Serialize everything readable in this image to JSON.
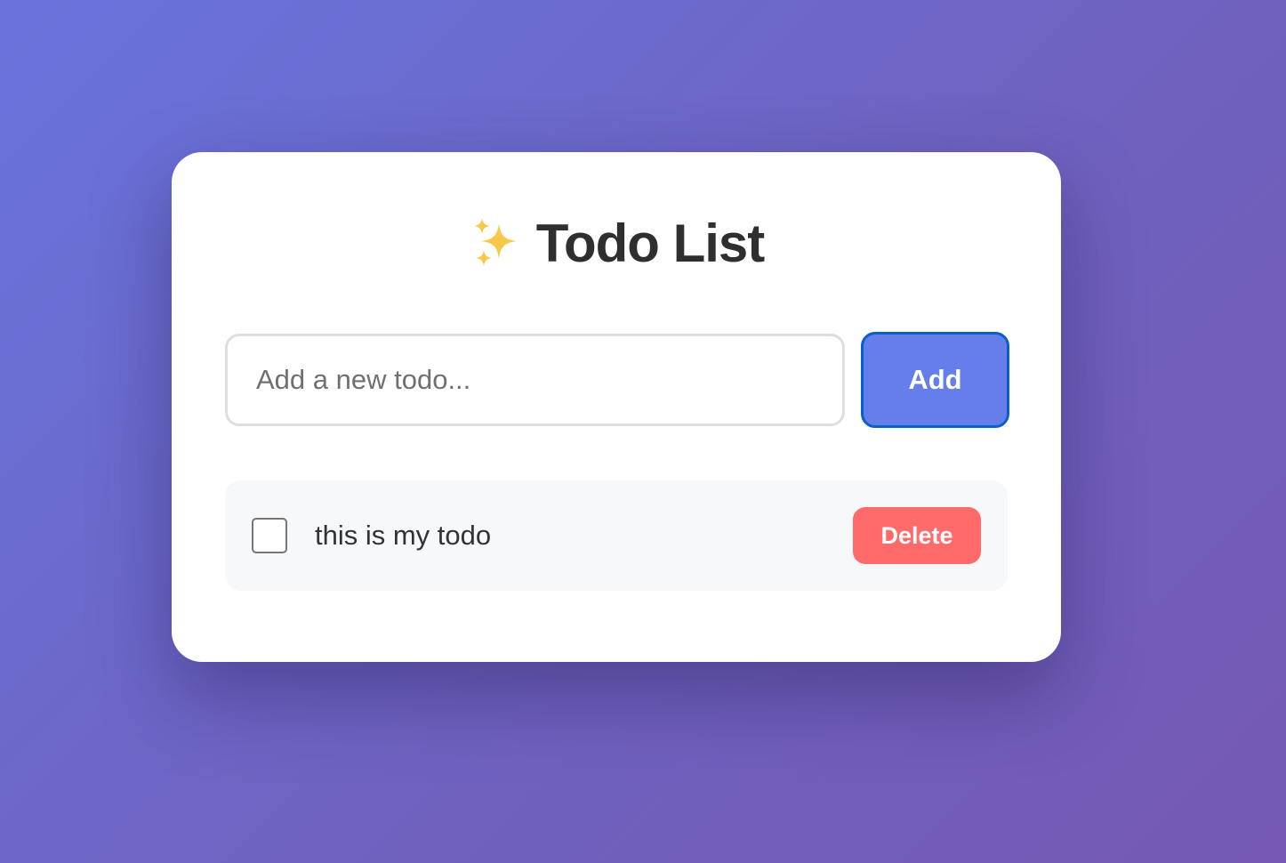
{
  "header": {
    "icon": "sparkles-icon",
    "title": "Todo List"
  },
  "new_todo": {
    "input_value": "",
    "placeholder": "Add a new todo...",
    "add_label": "Add"
  },
  "todos": [
    {
      "text": "this is my todo",
      "completed": false,
      "delete_label": "Delete"
    }
  ],
  "colors": {
    "background_start": "#6874dc",
    "background_end": "#7559b3",
    "card": "#ffffff",
    "add_button": "#667eea",
    "add_button_focus_border": "#0a5fc9",
    "delete_button": "#ff6b6b",
    "title_text": "#2f2f2f",
    "todo_item_background": "#f7f8fa"
  }
}
